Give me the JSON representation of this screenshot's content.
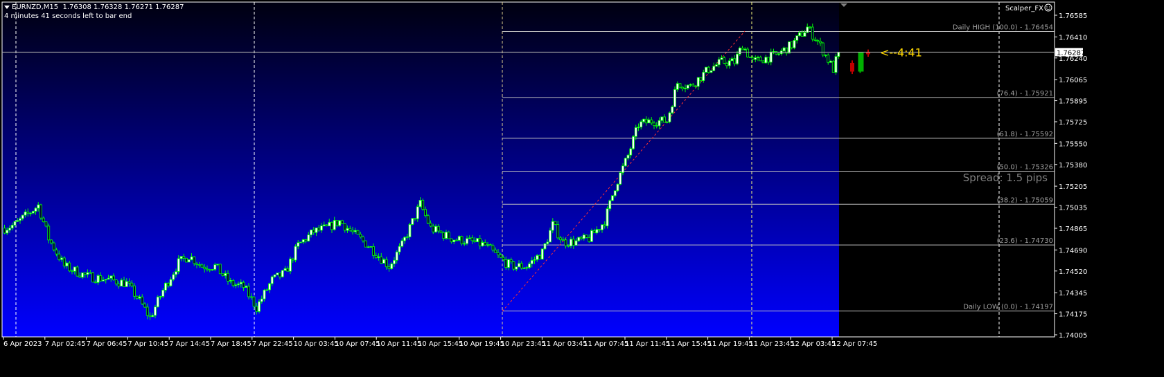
{
  "header": {
    "symbol_line": "EURNZD,M15  1.76308 1.76328 1.76271 1.76287",
    "timer_text": "4 minutes 41 seconds left to bar end"
  },
  "indicator_name": "Scalper_FX",
  "spread_text": "Spread: 1.5 pips",
  "countdown_text": "<--4:41",
  "current_price": "1.76287",
  "colors": {
    "bull": "#00ff00",
    "bear": "#00ff00",
    "future_bull": "#00b000",
    "future_bear": "#c00000",
    "bg_top": "#000000",
    "bg_bottom": "#0000ff",
    "countdown": "#ffd700"
  },
  "fib_levels": [
    {
      "label": "Daily HIGH (100.0) -  1.76454",
      "price": 1.76454
    },
    {
      "label": "(76.4) -  1.75921",
      "price": 1.75921
    },
    {
      "label": "(61.8) -  1.75592",
      "price": 1.75592
    },
    {
      "label": "(50.0) -  1.75326",
      "price": 1.75326
    },
    {
      "label": "(38.2) -  1.75059",
      "price": 1.75059
    },
    {
      "label": "(23.6) -  1.74730",
      "price": 1.7473
    },
    {
      "label": "Daily LOW (0.0) -  1.74197",
      "price": 1.74197
    }
  ],
  "chart_data": {
    "type": "candlestick",
    "title": "EURNZD,M15",
    "price_ticks": [
      "1.76585",
      "1.76410",
      "1.76240",
      "1.76065",
      "1.75895",
      "1.75725",
      "1.75550",
      "1.75380",
      "1.75205",
      "1.75035",
      "1.74865",
      "1.74690",
      "1.74520",
      "1.74345",
      "1.74175",
      "1.74005"
    ],
    "ylim": [
      1.74005,
      1.76585
    ],
    "time_ticks": [
      "6 Apr 2023",
      "7 Apr 02:45",
      "7 Apr 06:45",
      "7 Apr 10:45",
      "7 Apr 14:45",
      "7 Apr 18:45",
      "7 Apr 22:45",
      "10 Apr 03:45",
      "10 Apr 07:45",
      "10 Apr 11:45",
      "10 Apr 15:45",
      "10 Apr 19:45",
      "10 Apr 23:45",
      "11 Apr 03:45",
      "11 Apr 07:45",
      "11 Apr 11:45",
      "11 Apr 15:45",
      "11 Apr 19:45",
      "11 Apr 23:45",
      "12 Apr 03:45",
      "12 Apr 07:45"
    ],
    "close_path_by_bar": [
      [
        0,
        1.74866
      ],
      [
        4,
        1.74894
      ],
      [
        13,
        1.7505
      ],
      [
        17,
        1.74783
      ],
      [
        23,
        1.74559
      ],
      [
        32,
        1.74476
      ],
      [
        41,
        1.74448
      ],
      [
        47,
        1.7442
      ],
      [
        52,
        1.7428
      ],
      [
        56,
        1.74141
      ],
      [
        61,
        1.74364
      ],
      [
        67,
        1.74587
      ],
      [
        71,
        1.74643
      ],
      [
        76,
        1.74559
      ],
      [
        81,
        1.74559
      ],
      [
        87,
        1.7442
      ],
      [
        92,
        1.74392
      ],
      [
        97,
        1.74225
      ],
      [
        103,
        1.74448
      ],
      [
        108,
        1.74504
      ],
      [
        113,
        1.74727
      ],
      [
        119,
        1.74838
      ],
      [
        124,
        1.74866
      ],
      [
        129,
        1.74922
      ],
      [
        135,
        1.7481
      ],
      [
        140,
        1.74727
      ],
      [
        148,
        1.74559
      ],
      [
        153,
        1.74727
      ],
      [
        160,
        1.75062
      ],
      [
        164,
        1.74866
      ],
      [
        172,
        1.74783
      ],
      [
        180,
        1.74755
      ],
      [
        185,
        1.74727
      ],
      [
        191,
        1.74615
      ],
      [
        195,
        1.74559
      ],
      [
        201,
        1.74559
      ],
      [
        207,
        1.74671
      ],
      [
        211,
        1.74894
      ],
      [
        215,
        1.74755
      ],
      [
        220,
        1.74755
      ],
      [
        225,
        1.74783
      ],
      [
        231,
        1.74922
      ],
      [
        235,
        1.75201
      ],
      [
        240,
        1.75452
      ],
      [
        244,
        1.75703
      ],
      [
        249,
        1.75731
      ],
      [
        255,
        1.75731
      ],
      [
        259,
        1.76038
      ],
      [
        264,
        1.7601
      ],
      [
        271,
        1.7615
      ],
      [
        276,
        1.76206
      ],
      [
        281,
        1.76206
      ],
      [
        284,
        1.76345
      ],
      [
        288,
        1.76206
      ],
      [
        292,
        1.76234
      ],
      [
        297,
        1.76262
      ],
      [
        303,
        1.76345
      ],
      [
        309,
        1.76485
      ],
      [
        313,
        1.76373
      ],
      [
        319,
        1.7615
      ],
      [
        321,
        1.76287
      ]
    ],
    "future_candles": [
      {
        "open": 1.762,
        "close": 1.7613,
        "high": 1.7622,
        "low": 1.7611,
        "dir": "bear"
      },
      {
        "open": 1.7613,
        "close": 1.76287,
        "high": 1.76287,
        "low": 1.7612,
        "dir": "bull"
      },
      {
        "open": 1.76287,
        "close": 1.7627,
        "high": 1.76308,
        "low": 1.7625,
        "dir": "bear"
      }
    ]
  }
}
